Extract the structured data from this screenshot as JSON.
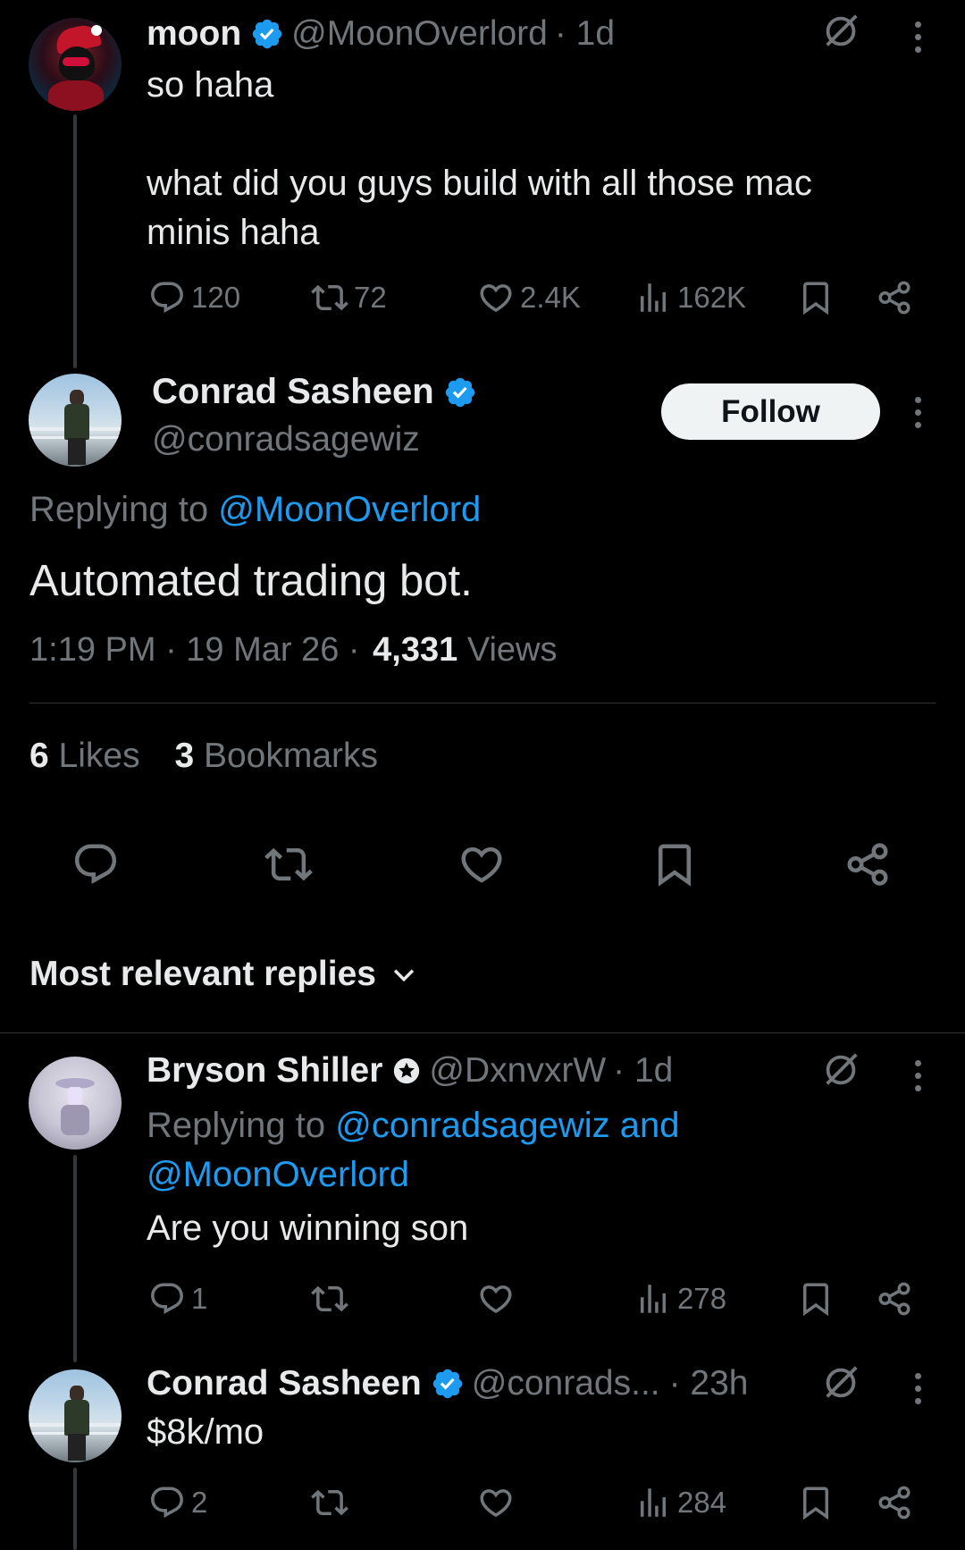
{
  "tweet1": {
    "name": "moon",
    "handle": "@MoonOverlord",
    "time": "· 1d",
    "line1": "so haha",
    "line2": "what did you guys build with all those mac",
    "line3": "minis haha",
    "replies": "120",
    "reposts": "72",
    "likes": "2.4K",
    "views": "162K"
  },
  "main": {
    "name": "Conrad Sasheen",
    "handle": "@conradsagewiz",
    "follow_label": "Follow",
    "replying_prefix": "Replying to",
    "replying_to": "@MoonOverlord",
    "text": "Automated trading bot.",
    "time": "1:19 PM · 19 Mar 26 ·",
    "views_count": "4,331",
    "views_label": "Views",
    "likes_count": "6",
    "likes_label": "Likes",
    "bookmarks_count": "3",
    "bookmarks_label": "Bookmarks"
  },
  "sort": {
    "label": "Most relevant replies"
  },
  "reply1": {
    "name": "Bryson Shiller",
    "handle": "@DxnvxrW",
    "time": "· 1d",
    "replying_prefix": "Replying to",
    "replying_to_line1": "@conradsagewiz and",
    "replying_to_line2": "@MoonOverlord",
    "text": "Are you winning son",
    "replies": "1",
    "views": "278"
  },
  "reply2": {
    "name": "Conrad Sasheen",
    "handle": "@conrads...",
    "time": "· 23h",
    "text": "$8k/mo",
    "replies": "2",
    "views": "284"
  },
  "colors": {
    "background": "#000000",
    "accent": "#1d9bf0",
    "muted": "#71767b",
    "text": "#e7e9ea"
  }
}
